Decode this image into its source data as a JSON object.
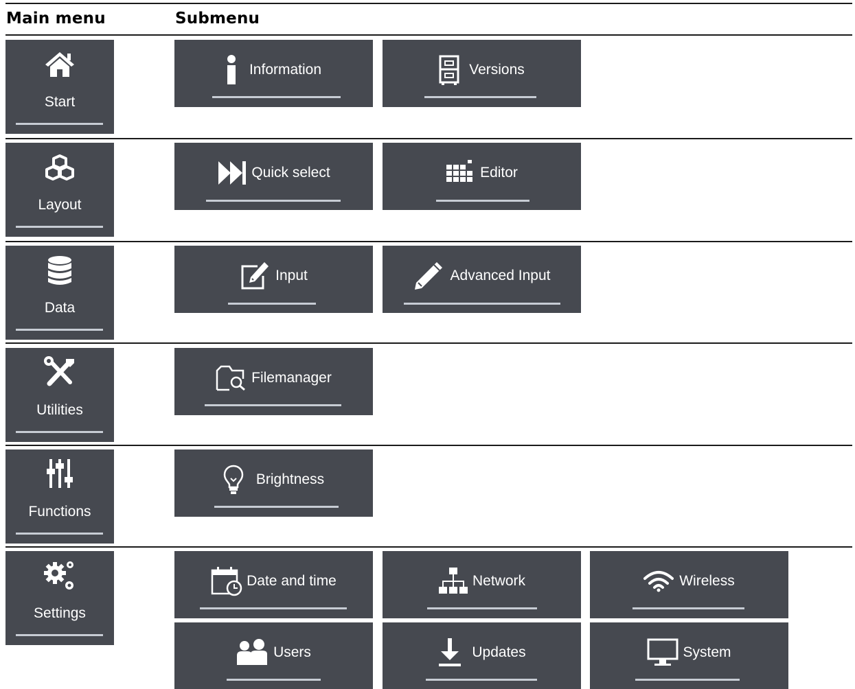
{
  "headers": {
    "main": "Main menu",
    "sub": "Submenu"
  },
  "colors": {
    "tile_bg": "#464950",
    "underline": "#c7ccd4",
    "text": "#ffffff",
    "rule": "#1a1a1a"
  },
  "main_menu": [
    {
      "label": "Start",
      "icon": "home-icon"
    },
    {
      "label": "Layout",
      "icon": "cubes-icon"
    },
    {
      "label": "Data",
      "icon": "database-icon"
    },
    {
      "label": "Utilities",
      "icon": "tools-icon"
    },
    {
      "label": "Functions",
      "icon": "sliders-icon"
    },
    {
      "label": "Settings",
      "icon": "gears-icon"
    }
  ],
  "submenu": {
    "start": [
      {
        "label": "Information",
        "icon": "info-icon"
      },
      {
        "label": "Versions",
        "icon": "cabinet-icon"
      }
    ],
    "layout": [
      {
        "label": "Quick select",
        "icon": "fast-forward-icon"
      },
      {
        "label": "Editor",
        "icon": "grid-icon"
      }
    ],
    "data": [
      {
        "label": "Input",
        "icon": "edit-icon"
      },
      {
        "label": "Advanced Input",
        "icon": "pencil-icon"
      }
    ],
    "utilities": [
      {
        "label": "Filemanager",
        "icon": "folder-search-icon"
      }
    ],
    "functions": [
      {
        "label": "Brightness",
        "icon": "lightbulb-icon"
      }
    ],
    "settings": [
      {
        "label": "Date and time",
        "icon": "calendar-clock-icon"
      },
      {
        "label": "Network",
        "icon": "network-icon"
      },
      {
        "label": "Wireless",
        "icon": "wifi-icon"
      },
      {
        "label": "Users",
        "icon": "users-icon"
      },
      {
        "label": "Updates",
        "icon": "download-icon"
      },
      {
        "label": "System",
        "icon": "monitor-icon"
      }
    ]
  }
}
